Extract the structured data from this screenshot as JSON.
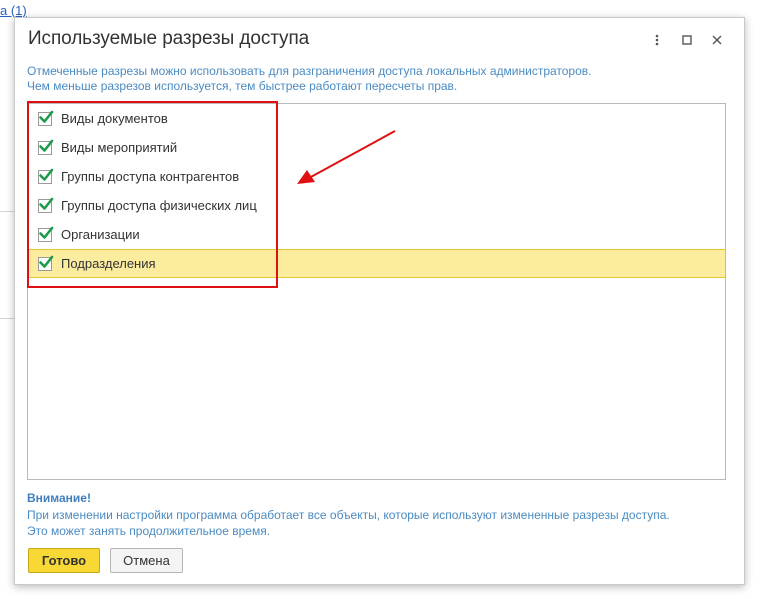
{
  "background": {
    "link_text": "а (1)"
  },
  "dialog": {
    "title": "Используемые разрезы доступа",
    "buttons": {
      "more": "more-vertical-icon",
      "maximize": "maximize-icon",
      "close": "close-icon"
    }
  },
  "info": {
    "line1": "Отмеченные разрезы можно использовать для разграничения доступа локальных администраторов.",
    "line2": "Чем меньше разрезов используется, тем быстрее работают пересчеты прав."
  },
  "items": [
    {
      "label": "Виды документов",
      "checked": true
    },
    {
      "label": "Виды мероприятий",
      "checked": true
    },
    {
      "label": "Группы доступа контрагентов",
      "checked": true
    },
    {
      "label": "Группы доступа физических лиц",
      "checked": true
    },
    {
      "label": "Организации",
      "checked": true
    },
    {
      "label": "Подразделения",
      "checked": true,
      "selected": true
    }
  ],
  "warning": {
    "title": "Внимание!",
    "line1": "При изменении настройки программа обработает все объекты, которые используют измененные разрезы доступа.",
    "line2": "Это может занять продолжительное время."
  },
  "footer": {
    "ok_label": "Готово",
    "cancel_label": "Отмена"
  },
  "colors": {
    "accent_yellow": "#f7d835",
    "selection": "#fbec9e",
    "check_green": "#1d9a4a",
    "annotation_red": "#e01010",
    "info_blue": "#4a8bc2"
  }
}
